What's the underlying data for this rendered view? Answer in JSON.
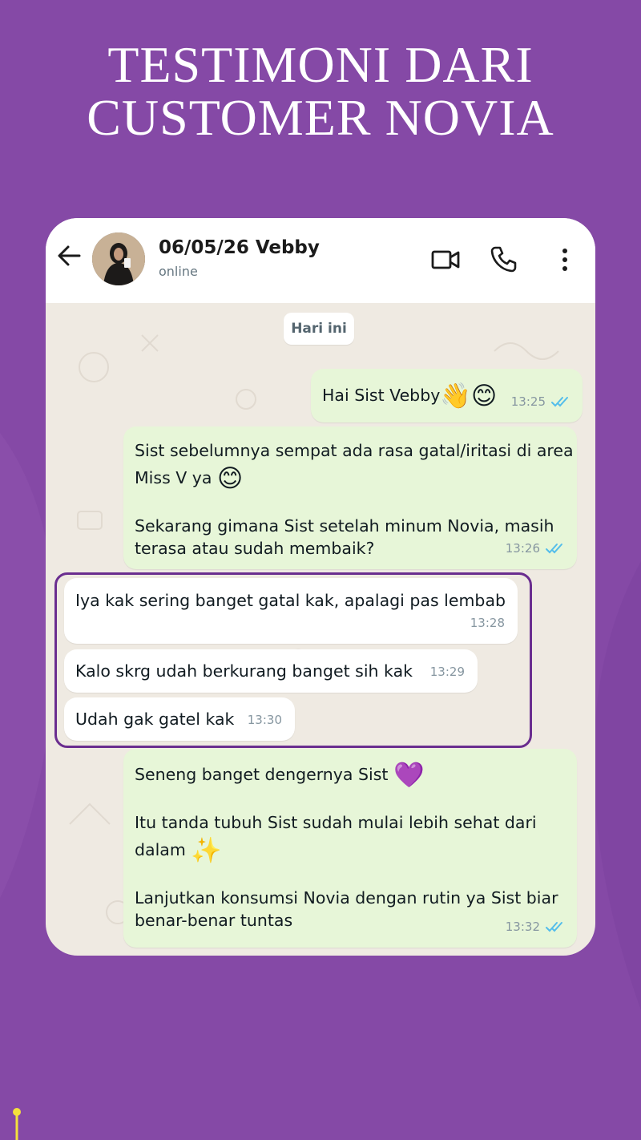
{
  "headline": {
    "line1": "TESTIMONI DARI",
    "line2": "CUSTOMER NOVIA"
  },
  "colors": {
    "background": "#8549a6",
    "bubble_out": "#e7f6d8",
    "bubble_in": "#ffffff",
    "highlight": "#6a2d8f",
    "read_ticks": "#53bdeb"
  },
  "header": {
    "back_icon": "arrow-left-icon",
    "avatar_icon": "contact-avatar",
    "contact_name": "06/05/26 Vebby",
    "status": "online",
    "video_icon": "video-call-icon",
    "call_icon": "phone-icon",
    "menu_icon": "more-vert-icon"
  },
  "chat": {
    "date_label": "Hari ini",
    "messages": [
      {
        "direction": "out",
        "text": "Hai Sist Vebby",
        "emoji": "👋😊",
        "time": "13:25",
        "ticks": "read"
      },
      {
        "direction": "out",
        "p1": "Sist sebelumnya sempat ada rasa gatal/iritasi di area",
        "p2": "Miss V ya ",
        "emoji": "😊",
        "p3": "Sekarang gimana Sist setelah minum Novia, masih",
        "p4": "terasa atau sudah membaik?",
        "time": "13:26",
        "ticks": "read"
      },
      {
        "direction": "in",
        "text": "Iya kak sering banget gatal kak, apalagi pas lembab",
        "time": "13:28"
      },
      {
        "direction": "in",
        "text": "Kalo skrg udah berkurang banget sih kak",
        "time": "13:29"
      },
      {
        "direction": "in",
        "text": "Udah gak gatel kak",
        "time": "13:30"
      },
      {
        "direction": "out",
        "p1": "Seneng banget dengernya Sist ",
        "emoji1": "💜",
        "p2": "Itu tanda tubuh Sist sudah mulai lebih sehat dari",
        "p3": "dalam ",
        "emoji2": "✨",
        "p4": "Lanjutkan konsumsi Novia dengan rutin ya Sist biar",
        "p5": "benar-benar tuntas",
        "time": "13:32",
        "ticks": "read"
      }
    ]
  }
}
